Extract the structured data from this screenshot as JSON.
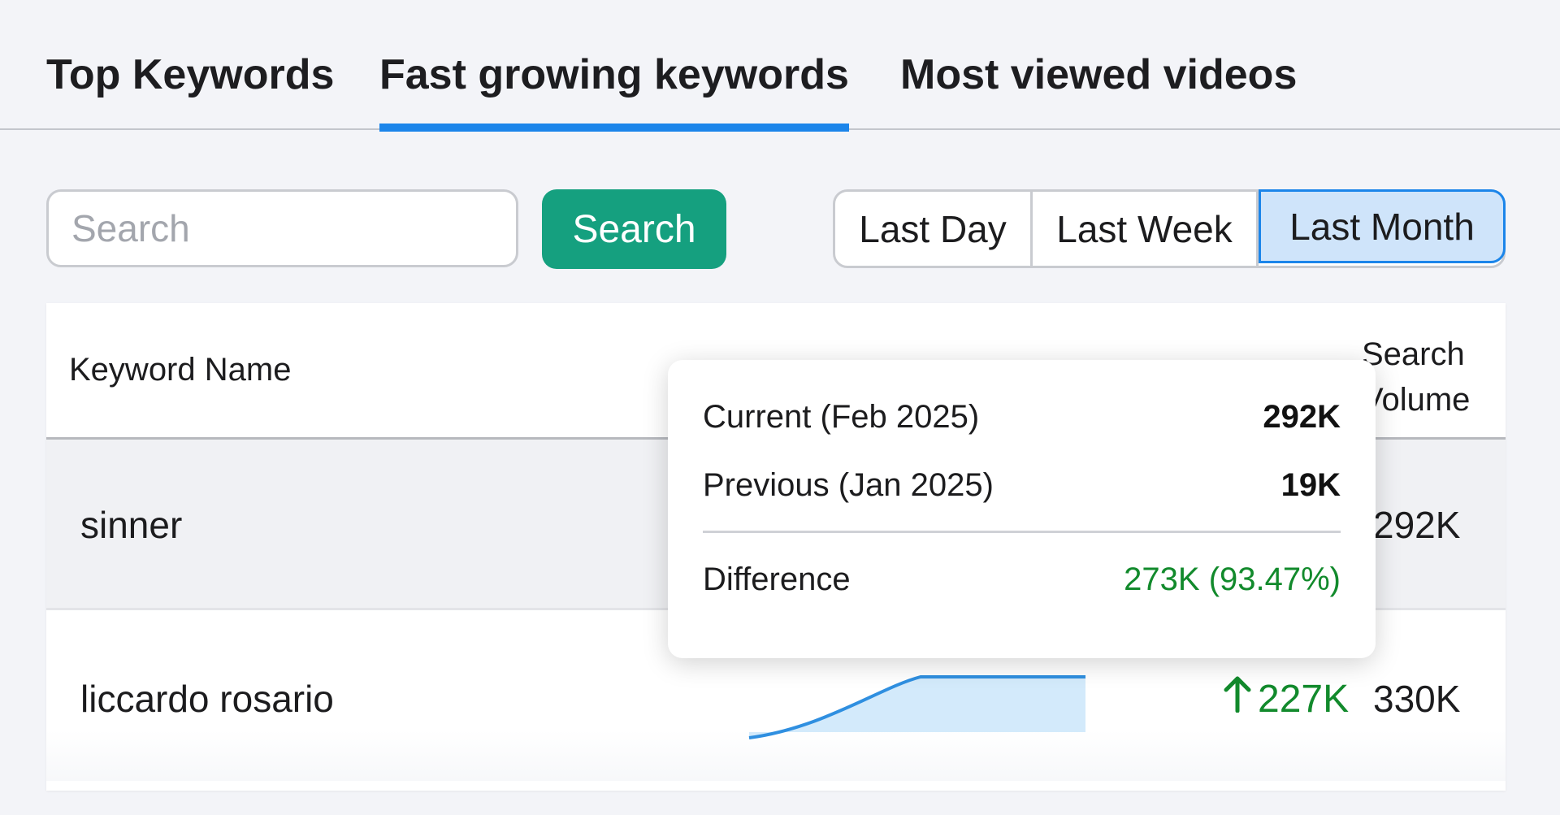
{
  "tabs": [
    {
      "label": "Top Keywords",
      "active": false
    },
    {
      "label": "Fast growing keywords",
      "active": true
    },
    {
      "label": "Most viewed videos",
      "active": false
    }
  ],
  "search": {
    "placeholder": "Search",
    "value": "",
    "button_label": "Search"
  },
  "range": {
    "options": [
      "Last Day",
      "Last Week",
      "Last Month"
    ],
    "selected": "Last Month"
  },
  "table": {
    "headers": {
      "keyword": "Keyword Name",
      "volume": "Search Volume"
    },
    "rows": [
      {
        "keyword": "sinner",
        "growth": "",
        "volume": "292K"
      },
      {
        "keyword": "liccardo rosario",
        "growth": "227K",
        "volume": "330K"
      }
    ]
  },
  "tooltip": {
    "current_label": "Current (Feb 2025)",
    "current_value": "292K",
    "previous_label": "Previous (Jan 2025)",
    "previous_value": "19K",
    "difference_label": "Difference",
    "difference_value": "273K (93.47%)"
  },
  "colors": {
    "accent": "#1b85ea",
    "search_button": "#15a07f",
    "positive": "#128a2c",
    "selected_segment": "#cfe4fa"
  },
  "icons": {
    "growth": "arrow-up-icon"
  }
}
